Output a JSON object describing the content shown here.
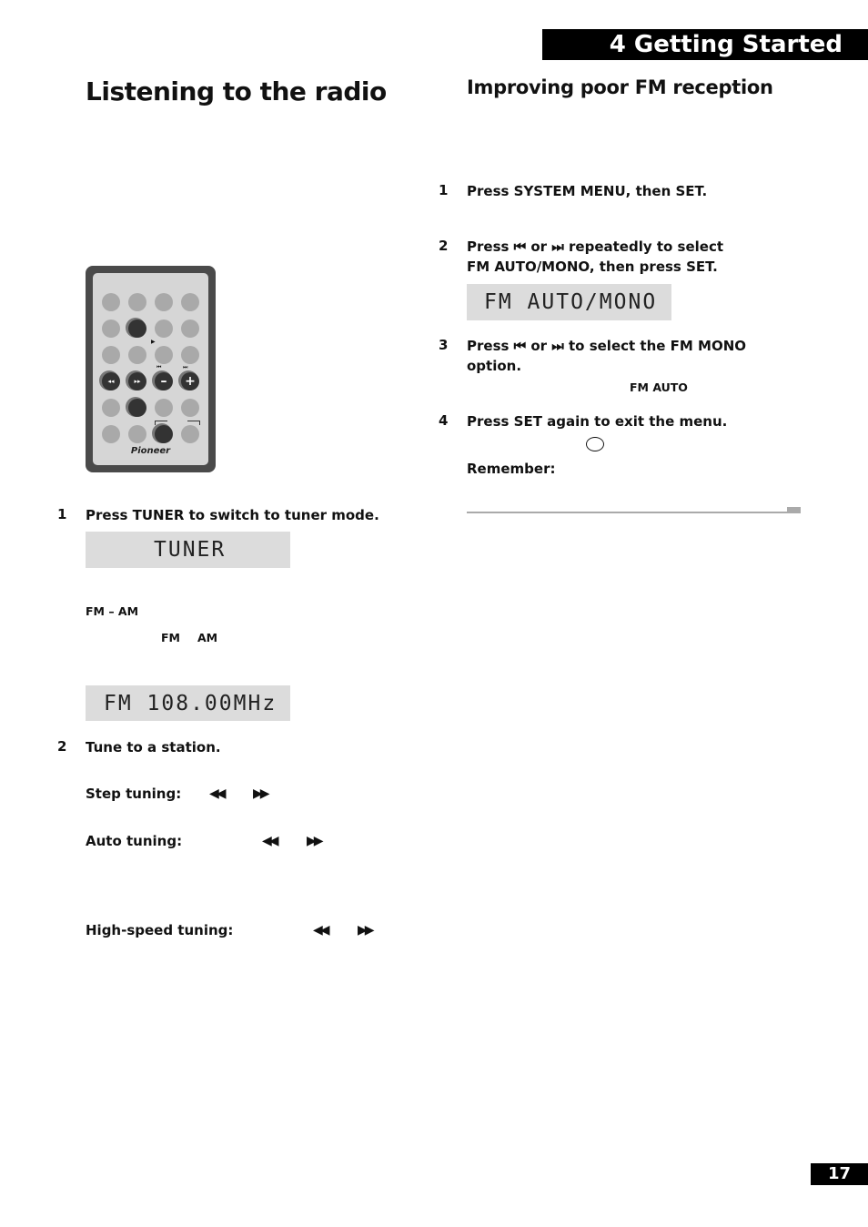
{
  "header": {
    "chapter": "4  Getting Started"
  },
  "left": {
    "title": "Listening to the radio",
    "remote": {
      "brand": "Pioneer",
      "button_labels": {
        "rewind": "◂◂",
        "fastforward": "▸▸",
        "minus": "–",
        "plus": "+",
        "prev": "⏮",
        "next": "⏭"
      }
    },
    "step1": {
      "num": "1",
      "text": "Press TUNER to switch to tuner mode.",
      "display": "TUNER"
    },
    "band_toggle": "FM – AM",
    "band_fm": "FM",
    "band_am": "AM",
    "freq_display": "FM 108.00MHz",
    "step2": {
      "num": "2",
      "text": "Tune to a station."
    },
    "tuning": [
      {
        "label": "Step tuning:",
        "rew": "◀◀",
        "ff": "▶▶"
      },
      {
        "label": "Auto tuning:",
        "rew": "◀◀",
        "ff": "▶▶"
      },
      {
        "label": "High-speed tuning:",
        "rew": "◀◀",
        "ff": "▶▶"
      }
    ]
  },
  "right": {
    "title": "Improving poor FM reception",
    "steps": [
      {
        "num": "1",
        "text": "Press SYSTEM MENU, then SET."
      },
      {
        "num": "2",
        "line1": "Press ⏮ or ⏭ repeatedly to select",
        "line2": "FM AUTO/MONO, then press SET."
      },
      {
        "num": "3",
        "line1": "Press ⏮ or ⏭ to select the FM MONO",
        "line2": "option."
      },
      {
        "num": "4",
        "text": "Press SET again to exit the menu."
      }
    ],
    "display": "FM AUTO/MONO",
    "fm_auto_note": "FM AUTO",
    "remember_label": "Remember:"
  },
  "footer": {
    "page_number": "17"
  }
}
